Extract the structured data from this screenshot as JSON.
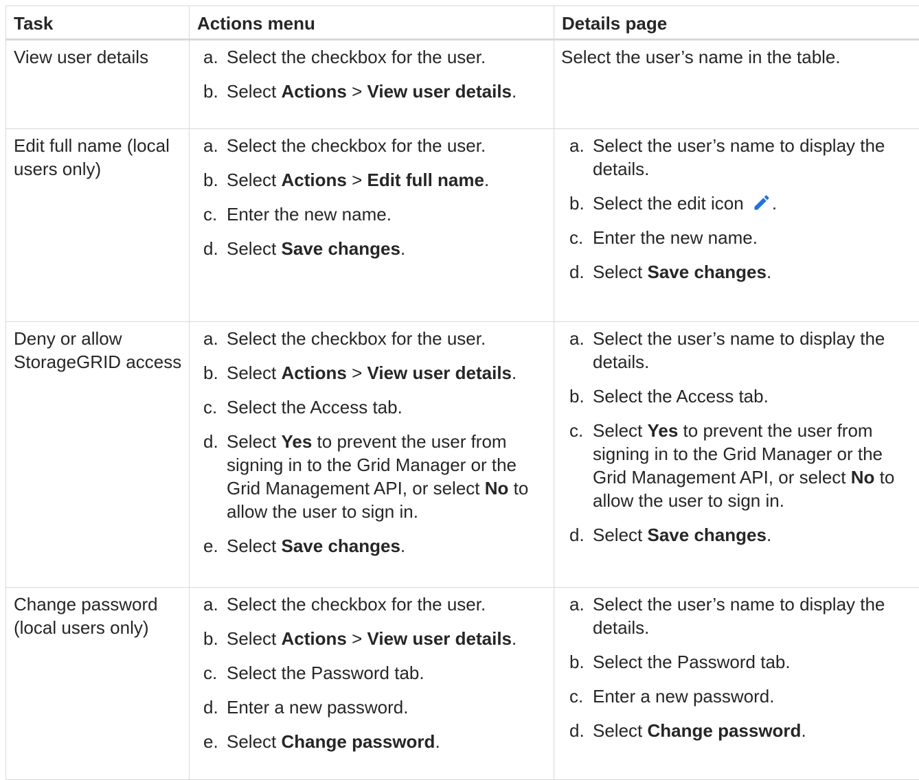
{
  "headers": [
    "Task",
    "Actions menu",
    "Details page"
  ],
  "colors": {
    "icon": "#1a73e8",
    "border": "#d9d9d9",
    "text": "#262626"
  },
  "rows": [
    {
      "task": "View user details",
      "actions": [
        {
          "m": "a.",
          "parts": [
            {
              "t": "Select the checkbox for the user."
            }
          ]
        },
        {
          "m": "b.",
          "parts": [
            {
              "t": "Select "
            },
            {
              "b": "Actions"
            },
            {
              "t": " > "
            },
            {
              "b": "View user details"
            },
            {
              "t": "."
            }
          ]
        }
      ],
      "details_text": "Select the user’s name in the table."
    },
    {
      "task": "Edit full name (local users only)",
      "actions": [
        {
          "m": "a.",
          "parts": [
            {
              "t": "Select the checkbox for the user."
            }
          ]
        },
        {
          "m": "b.",
          "parts": [
            {
              "t": "Select "
            },
            {
              "b": "Actions"
            },
            {
              "t": " > "
            },
            {
              "b": "Edit full name"
            },
            {
              "t": "."
            }
          ]
        },
        {
          "m": "c.",
          "parts": [
            {
              "t": "Enter the new name."
            }
          ]
        },
        {
          "m": "d.",
          "parts": [
            {
              "t": "Select "
            },
            {
              "b": "Save changes"
            },
            {
              "t": "."
            }
          ]
        }
      ],
      "details": [
        {
          "m": "a.",
          "parts": [
            {
              "t": "Select the user’s name to display the details."
            }
          ]
        },
        {
          "m": "b.",
          "parts": [
            {
              "t": "Select the edit icon "
            },
            {
              "icon": "edit-pencil"
            },
            {
              "t": "."
            }
          ]
        },
        {
          "m": "c.",
          "parts": [
            {
              "t": "Enter the new name."
            }
          ]
        },
        {
          "m": "d.",
          "parts": [
            {
              "t": "Select "
            },
            {
              "b": "Save changes"
            },
            {
              "t": "."
            }
          ]
        }
      ]
    },
    {
      "task": "Deny or allow StorageGRID access",
      "actions": [
        {
          "m": "a.",
          "parts": [
            {
              "t": "Select the checkbox for the user."
            }
          ]
        },
        {
          "m": "b.",
          "parts": [
            {
              "t": "Select "
            },
            {
              "b": "Actions"
            },
            {
              "t": " > "
            },
            {
              "b": "View user details"
            },
            {
              "t": "."
            }
          ]
        },
        {
          "m": "c.",
          "parts": [
            {
              "t": "Select the Access tab."
            }
          ]
        },
        {
          "m": "d.",
          "parts": [
            {
              "t": "Select "
            },
            {
              "b": "Yes"
            },
            {
              "t": " to prevent the user from signing in to the Grid Manager or the Grid Management API, or select "
            },
            {
              "b": "No"
            },
            {
              "t": " to allow the user to sign in."
            }
          ]
        },
        {
          "m": "e.",
          "parts": [
            {
              "t": "Select "
            },
            {
              "b": "Save changes"
            },
            {
              "t": "."
            }
          ]
        }
      ],
      "details": [
        {
          "m": "a.",
          "parts": [
            {
              "t": "Select the user’s name to display the details."
            }
          ]
        },
        {
          "m": "b.",
          "parts": [
            {
              "t": "Select the Access tab."
            }
          ]
        },
        {
          "m": "c.",
          "parts": [
            {
              "t": "Select "
            },
            {
              "b": "Yes"
            },
            {
              "t": " to prevent the user from signing in to the Grid Manager or the Grid Management API, or select "
            },
            {
              "b": "No"
            },
            {
              "t": " to allow the user to sign in."
            }
          ]
        },
        {
          "m": "d.",
          "parts": [
            {
              "t": "Select "
            },
            {
              "b": "Save changes"
            },
            {
              "t": "."
            }
          ]
        }
      ]
    },
    {
      "task": "Change password (local users only)",
      "actions": [
        {
          "m": "a.",
          "parts": [
            {
              "t": "Select the checkbox for the user."
            }
          ]
        },
        {
          "m": "b.",
          "parts": [
            {
              "t": "Select "
            },
            {
              "b": "Actions"
            },
            {
              "t": " > "
            },
            {
              "b": "View user details"
            },
            {
              "t": "."
            }
          ]
        },
        {
          "m": "c.",
          "parts": [
            {
              "t": "Select the Password tab."
            }
          ]
        },
        {
          "m": "d.",
          "parts": [
            {
              "t": "Enter a new password."
            }
          ]
        },
        {
          "m": "e.",
          "parts": [
            {
              "t": "Select "
            },
            {
              "b": "Change password"
            },
            {
              "t": "."
            }
          ]
        }
      ],
      "details": [
        {
          "m": "a.",
          "parts": [
            {
              "t": "Select the user’s name to display the details."
            }
          ]
        },
        {
          "m": "b.",
          "parts": [
            {
              "t": "Select the Password tab."
            }
          ]
        },
        {
          "m": "c.",
          "parts": [
            {
              "t": "Enter a new password."
            }
          ]
        },
        {
          "m": "d.",
          "parts": [
            {
              "t": "Select "
            },
            {
              "b": "Change password"
            },
            {
              "t": "."
            }
          ]
        }
      ]
    }
  ]
}
